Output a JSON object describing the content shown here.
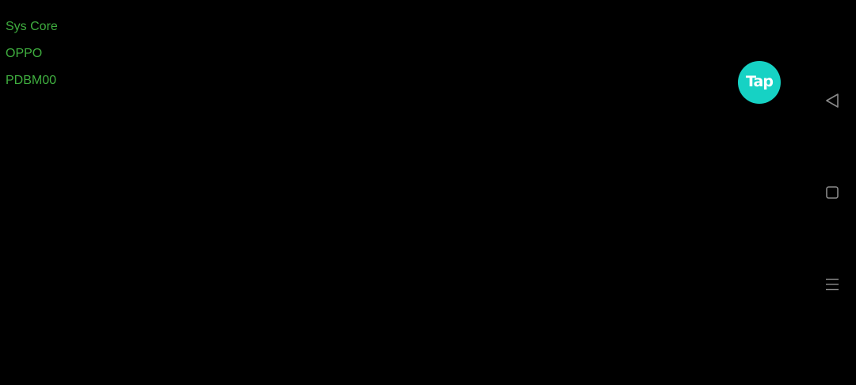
{
  "device_info": {
    "lines": [
      "Sys Core",
      "OPPO",
      "PDBM00"
    ]
  },
  "floating_button": {
    "label": "Tap",
    "icon": "taptap-logo-icon"
  },
  "nav_bar": {
    "items": [
      {
        "icon": "back-triangle-icon"
      },
      {
        "icon": "home-square-icon"
      },
      {
        "icon": "menu-lines-icon"
      }
    ]
  },
  "colors": {
    "background": "#000000",
    "info_text": "#3fae3f",
    "tap_accent": "#16d2c4",
    "nav_icon": "#8a8a8a"
  }
}
